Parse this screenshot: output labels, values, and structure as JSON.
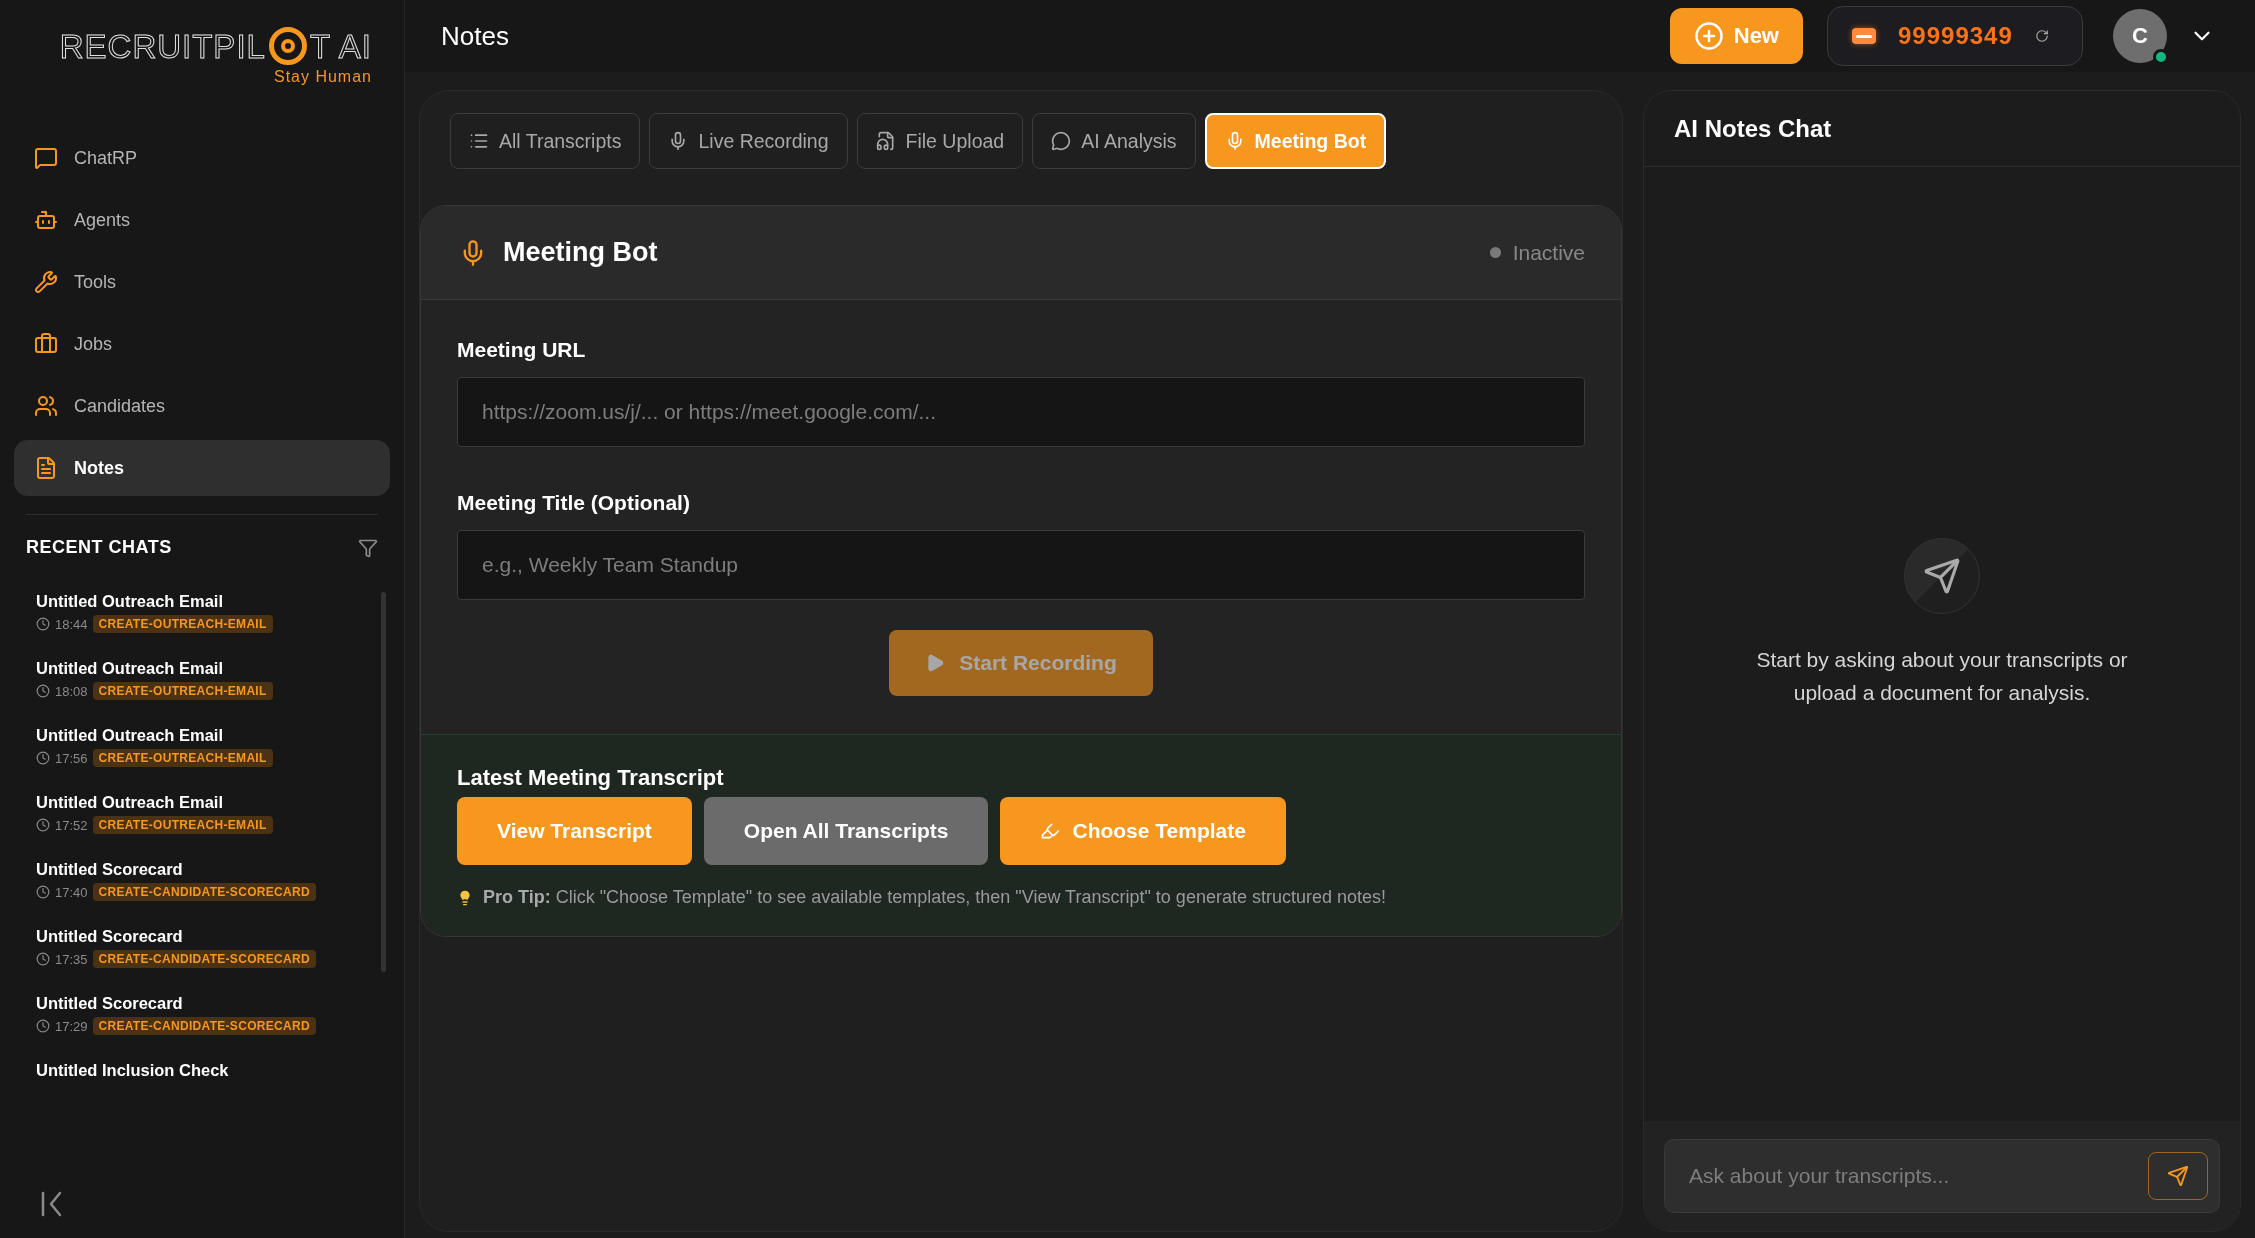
{
  "logo": {
    "before": "RECRUITPIL",
    "after": "T AI",
    "tagline": "Stay Human"
  },
  "nav": [
    {
      "label": "ChatRP",
      "selected": false
    },
    {
      "label": "Agents",
      "selected": false
    },
    {
      "label": "Tools",
      "selected": false
    },
    {
      "label": "Jobs",
      "selected": false
    },
    {
      "label": "Candidates",
      "selected": false
    },
    {
      "label": "Notes",
      "selected": true
    }
  ],
  "recent_chats": {
    "title": "RECENT CHATS",
    "items": [
      {
        "title": "Untitled Outreach Email",
        "time": "18:44",
        "tag": "CREATE-OUTREACH-EMAIL"
      },
      {
        "title": "Untitled Outreach Email",
        "time": "18:08",
        "tag": "CREATE-OUTREACH-EMAIL"
      },
      {
        "title": "Untitled Outreach Email",
        "time": "17:56",
        "tag": "CREATE-OUTREACH-EMAIL"
      },
      {
        "title": "Untitled Outreach Email",
        "time": "17:52",
        "tag": "CREATE-OUTREACH-EMAIL"
      },
      {
        "title": "Untitled Scorecard",
        "time": "17:40",
        "tag": "CREATE-CANDIDATE-SCORECARD"
      },
      {
        "title": "Untitled Scorecard",
        "time": "17:35",
        "tag": "CREATE-CANDIDATE-SCORECARD"
      },
      {
        "title": "Untitled Scorecard",
        "time": "17:29",
        "tag": "CREATE-CANDIDATE-SCORECARD"
      },
      {
        "title": "Untitled Inclusion Check"
      }
    ]
  },
  "header": {
    "title": "Notes",
    "new_button": "New",
    "credits": "99999349",
    "avatar": "C",
    "online": true
  },
  "tabs": [
    {
      "label": "All Transcripts",
      "selected": false
    },
    {
      "label": "Live Recording",
      "selected": false
    },
    {
      "label": "File Upload",
      "selected": false
    },
    {
      "label": "AI Analysis",
      "selected": false
    },
    {
      "label": "Meeting Bot",
      "selected": true
    }
  ],
  "meeting_bot": {
    "title": "Meeting Bot",
    "status": "Inactive",
    "active": false,
    "fields": [
      {
        "label": "Meeting URL",
        "placeholder": "https://zoom.us/j/... or https://meet.google.com/..."
      },
      {
        "label": "Meeting Title (Optional)",
        "placeholder": "e.g., Weekly Team Standup"
      }
    ],
    "start_button": {
      "label": "Start Recording",
      "disabled": true
    }
  },
  "latest_transcript": {
    "title": "Latest Meeting Transcript",
    "buttons": [
      {
        "label": "View Transcript",
        "kind": "primary"
      },
      {
        "label": "Open All Transcripts",
        "kind": "secondary"
      },
      {
        "label": "Choose Template",
        "kind": "template"
      }
    ],
    "tip": "**Pro Tip:** Click \"Choose Template\" to see available templates, then \"View Transcript\" to generate structured notes!"
  },
  "chat": {
    "title": "AI Notes Chat",
    "empty_message": "Start by asking about your transcripts or upload a document for analysis.",
    "placeholder": "Ask about your transcripts..."
  }
}
